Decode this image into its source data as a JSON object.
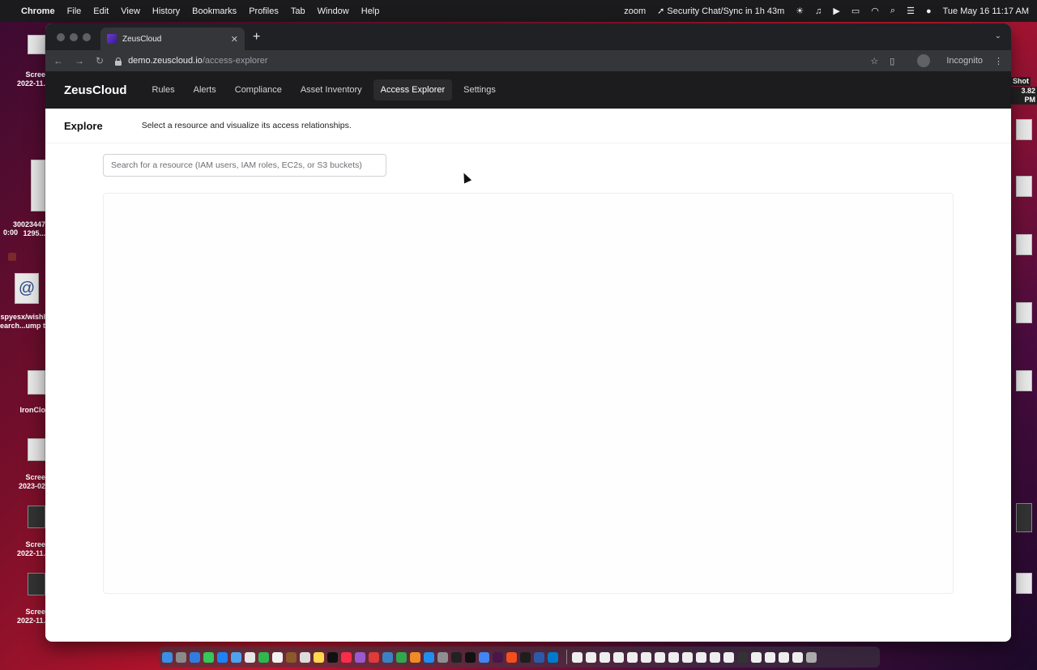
{
  "menubar": {
    "app": "Chrome",
    "items": [
      "File",
      "Edit",
      "View",
      "History",
      "Bookmarks",
      "Profiles",
      "Tab",
      "Window",
      "Help"
    ],
    "zoom": "zoom",
    "meeting": "Security Chat/Sync in 1h 43m",
    "datetime": "Tue May 16  11:17 AM"
  },
  "desktop": {
    "left_labels": [
      "Scree",
      "2022-11.",
      "30023447",
      "1295...",
      "0:00",
      "spyesx/wishl",
      "earch...ump t",
      "IronClo",
      "Scree",
      "2023-02",
      "Scree",
      "2022-11.",
      "Scree",
      "2022-11."
    ],
    "right_labels": [
      "Shot",
      "3.82 PM"
    ]
  },
  "browser": {
    "tab_title": "ZeusCloud",
    "url_host": "demo.zeuscloud.io",
    "url_path": "/access-explorer",
    "profile": "Incognito"
  },
  "app": {
    "brand": "ZeusCloud",
    "nav": [
      "Rules",
      "Alerts",
      "Compliance",
      "Asset Inventory",
      "Access Explorer",
      "Settings"
    ],
    "active_nav": "Access Explorer",
    "page_title": "Explore",
    "page_description": "Select a resource and visualize its access relationships.",
    "search_placeholder": "Search for a resource (IAM users, IAM roles, EC2s, or S3 buckets)"
  }
}
